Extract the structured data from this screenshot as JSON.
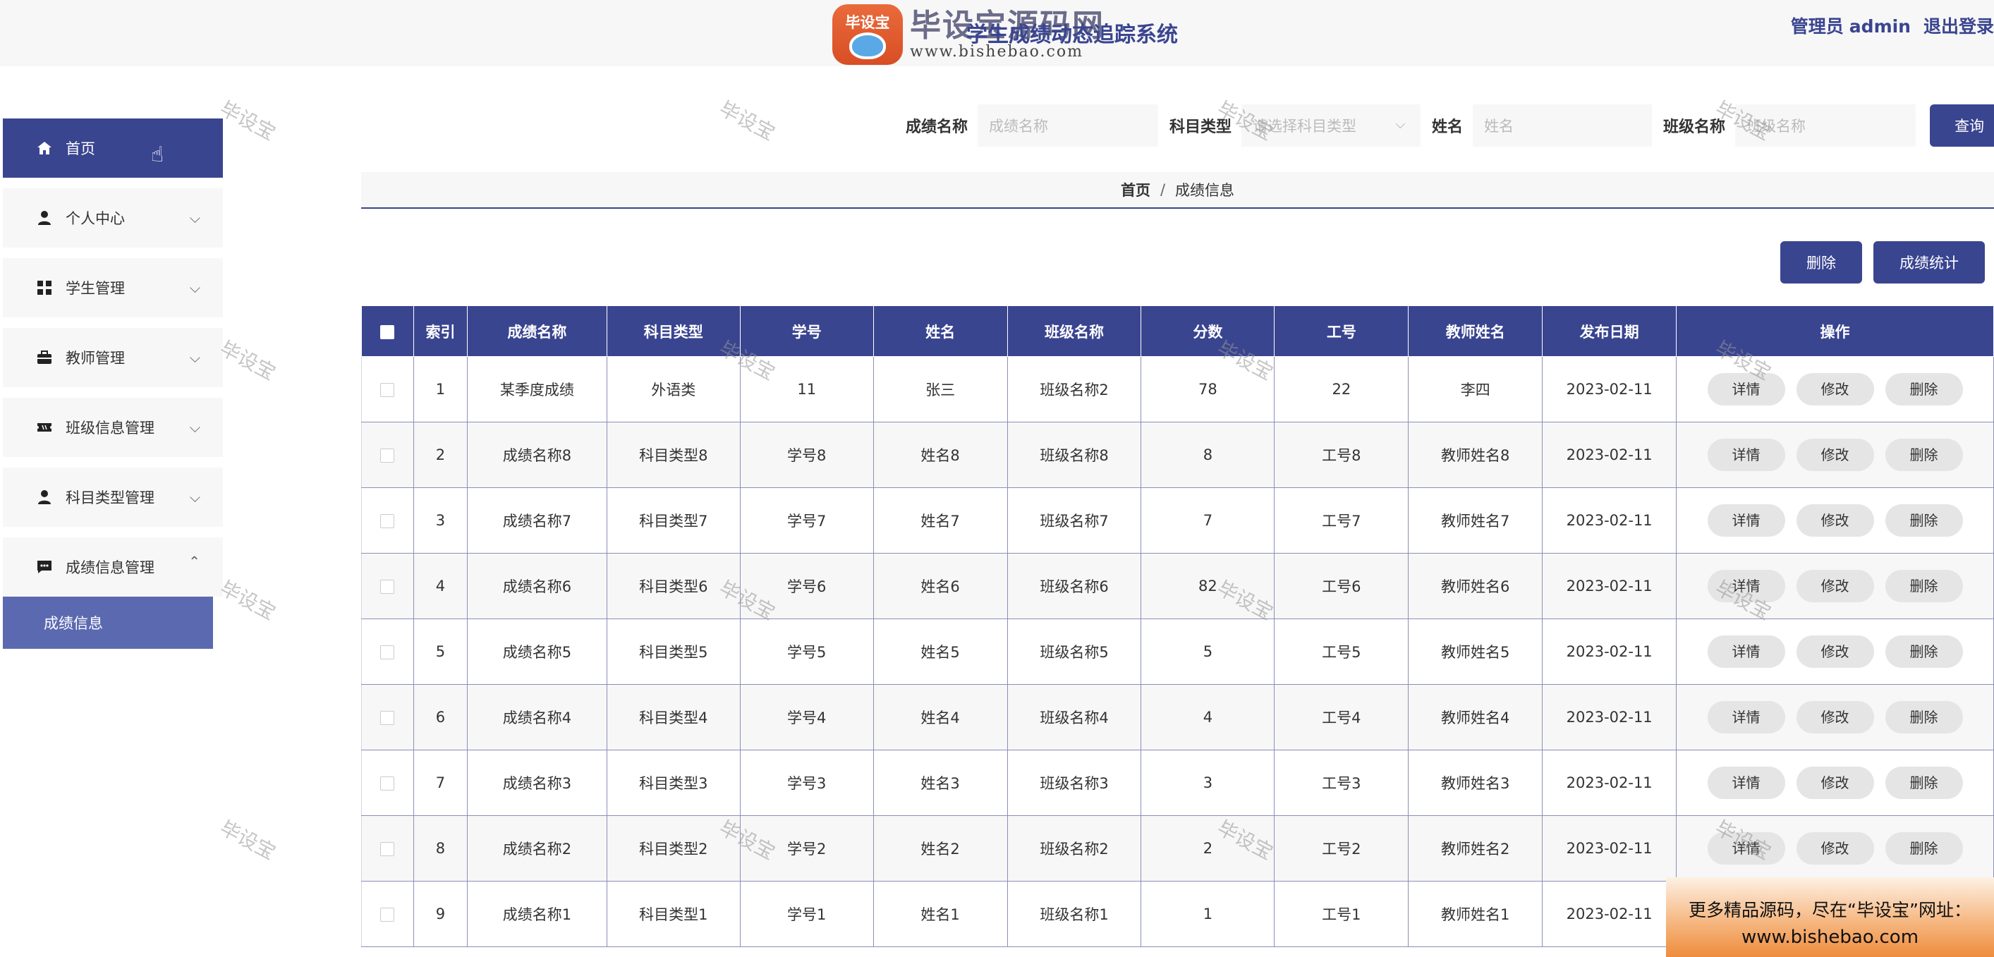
{
  "header": {
    "logo_badge": "毕设宝",
    "logo_text": "毕设宝源码网",
    "logo_url": "www.bishebao.com",
    "system_title": "学生成绩动态追踪系统",
    "user_role": "管理员",
    "user_name": "admin",
    "logout_label": "退出登录"
  },
  "sidebar": {
    "items": [
      {
        "label": "首页",
        "icon": "home-icon",
        "active": true
      },
      {
        "label": "个人中心",
        "icon": "person-icon"
      },
      {
        "label": "学生管理",
        "icon": "grid-icon"
      },
      {
        "label": "教师管理",
        "icon": "briefcase-icon"
      },
      {
        "label": "班级信息管理",
        "icon": "ticket-icon"
      },
      {
        "label": "科目类型管理",
        "icon": "person-icon"
      },
      {
        "label": "成绩信息管理",
        "icon": "chat-icon",
        "expanded": true
      }
    ],
    "submenu": {
      "label": "成绩信息"
    }
  },
  "search": {
    "score_name_label": "成绩名称",
    "score_name_placeholder": "成绩名称",
    "subject_type_label": "科目类型",
    "subject_type_placeholder": "请选择科目类型",
    "name_label": "姓名",
    "name_placeholder": "姓名",
    "class_name_label": "班级名称",
    "class_name_placeholder": "班级名称",
    "query_button": "查询"
  },
  "breadcrumb": {
    "home": "首页",
    "separator": "/",
    "current": "成绩信息"
  },
  "actions": {
    "delete": "删除",
    "stats": "成绩统计"
  },
  "table": {
    "columns": [
      "索引",
      "成绩名称",
      "科目类型",
      "学号",
      "姓名",
      "班级名称",
      "分数",
      "工号",
      "教师姓名",
      "发布日期",
      "操作"
    ],
    "row_actions": [
      "详情",
      "修改",
      "删除"
    ],
    "rows": [
      [
        "1",
        "某季度成绩",
        "外语类",
        "11",
        "张三",
        "班级名称2",
        "78",
        "22",
        "李四",
        "2023-02-11"
      ],
      [
        "2",
        "成绩名称8",
        "科目类型8",
        "学号8",
        "姓名8",
        "班级名称8",
        "8",
        "工号8",
        "教师姓名8",
        "2023-02-11"
      ],
      [
        "3",
        "成绩名称7",
        "科目类型7",
        "学号7",
        "姓名7",
        "班级名称7",
        "7",
        "工号7",
        "教师姓名7",
        "2023-02-11"
      ],
      [
        "4",
        "成绩名称6",
        "科目类型6",
        "学号6",
        "姓名6",
        "班级名称6",
        "82",
        "工号6",
        "教师姓名6",
        "2023-02-11"
      ],
      [
        "5",
        "成绩名称5",
        "科目类型5",
        "学号5",
        "姓名5",
        "班级名称5",
        "5",
        "工号5",
        "教师姓名5",
        "2023-02-11"
      ],
      [
        "6",
        "成绩名称4",
        "科目类型4",
        "学号4",
        "姓名4",
        "班级名称4",
        "4",
        "工号4",
        "教师姓名4",
        "2023-02-11"
      ],
      [
        "7",
        "成绩名称3",
        "科目类型3",
        "学号3",
        "姓名3",
        "班级名称3",
        "3",
        "工号3",
        "教师姓名3",
        "2023-02-11"
      ],
      [
        "8",
        "成绩名称2",
        "科目类型2",
        "学号2",
        "姓名2",
        "班级名称2",
        "2",
        "工号2",
        "教师姓名2",
        "2023-02-11"
      ],
      [
        "9",
        "成绩名称1",
        "科目类型1",
        "学号1",
        "姓名1",
        "班级名称1",
        "1",
        "工号1",
        "教师姓名1",
        "2023-02-11"
      ]
    ]
  },
  "watermark": "毕设宝",
  "promo": {
    "line1": "更多精品源码，尽在“毕设宝”网址：",
    "line2": "www.bishebao.com"
  },
  "colors": {
    "primary": "#3a4590",
    "submenu": "#5b6ab0",
    "panel": "#f7f7f7"
  }
}
